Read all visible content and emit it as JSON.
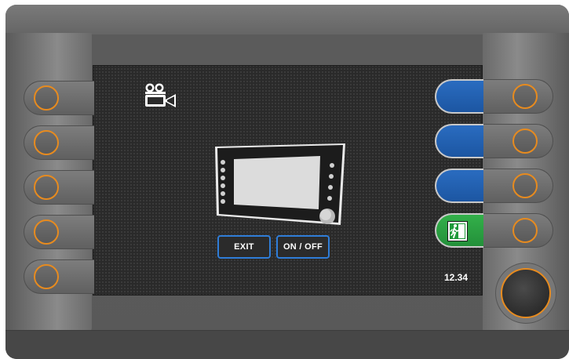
{
  "screen": {
    "buttons": {
      "exit_label": "EXIT",
      "onoff_label": "ON / OFF"
    },
    "clock": "12.34",
    "icons": {
      "top_left": "video-camera-icon",
      "center": "display-monitor-icon",
      "exit_soft_key": "emergency-exit-icon"
    }
  },
  "hardware": {
    "left_buttons_count": 5,
    "right_buttons_count": 4,
    "soft_keys": [
      "blank",
      "blank",
      "blank",
      "exit-sign"
    ]
  },
  "colors": {
    "accent_ring": "#e78b1f",
    "soft_key_blue": "#1f5cab",
    "soft_key_green": "#2aa042",
    "button_border": "#2f7dd8",
    "screen_bg": "#2a2a2a"
  }
}
